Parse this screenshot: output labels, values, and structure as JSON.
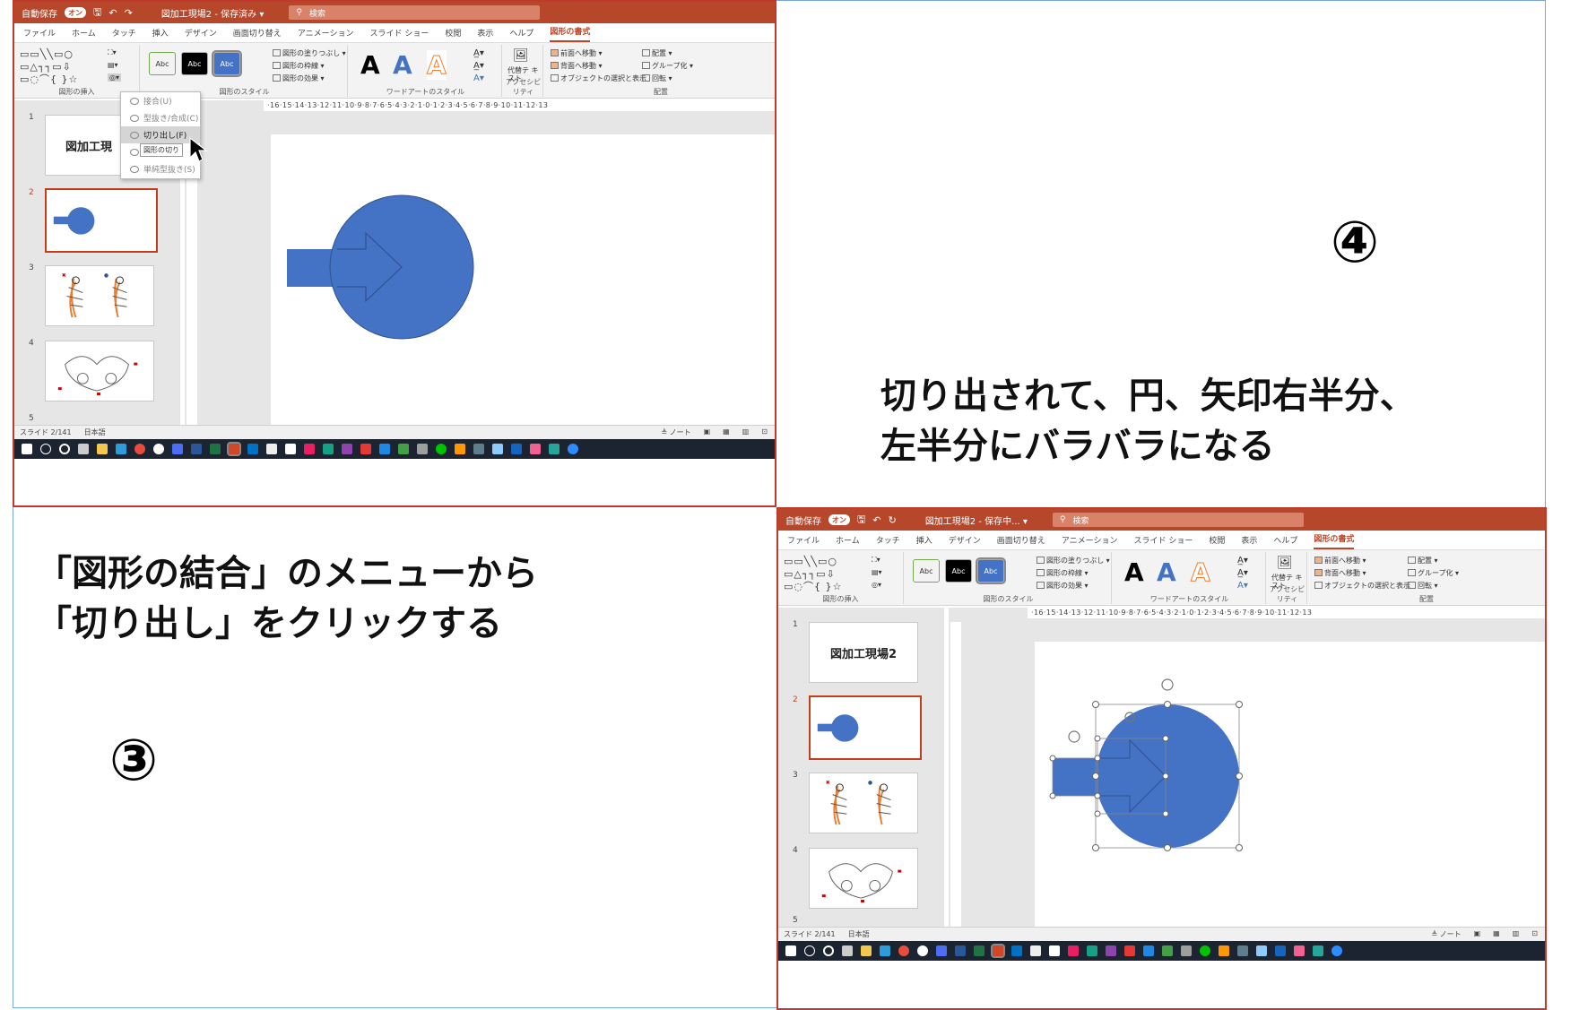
{
  "annotations": {
    "step3_number": "③",
    "step3_line1": "「図形の結合」のメニューから",
    "step3_line2": "「切り出し」をクリックする",
    "step4_number": "④",
    "step4_line1": "切り出されて、円、矢印右半分、",
    "step4_line2": "左半分にバラバラになる"
  },
  "colors": {
    "accent": "#b7472a",
    "shape_fill": "#4472c4",
    "shape_stroke": "#2f528f",
    "callout_border": "#c0392b"
  },
  "shot_a": {
    "title": {
      "autosave": "自動保存",
      "toggle": "オン",
      "doc": "図加工現場2 - 保存済み ▾",
      "search": "検索"
    },
    "tabs": [
      "ファイル",
      "ホーム",
      "タッチ",
      "挿入",
      "デザイン",
      "画面切り替え",
      "アニメーション",
      "スライド ショー",
      "校閲",
      "表示",
      "ヘルプ",
      "図形の書式"
    ],
    "ribbon": {
      "insert_shapes": "図形の挿入",
      "shape_styles": "図形のスタイル",
      "wordart_styles": "ワードアートのスタイル",
      "accessibility": "アクセシビリティ",
      "arrange": "配置",
      "alt_text": "代替テ キスト",
      "fill": "図形の塗りつぶし ▾",
      "outline": "図形の枠線 ▾",
      "effects": "図形の効果 ▾",
      "bring_forward": "前面へ移動",
      "send_backward": "背面へ移動",
      "selection_pane": "オブジェクトの選択と表示",
      "align": "配置 ▾",
      "group": "グループ化 ▾",
      "rotate": "回転 ▾",
      "abc": "Abc",
      "wa_letter": "A"
    },
    "merge_menu": [
      "接合(U)",
      "型抜き/合成(C)",
      "切り出し(F)",
      "重",
      "単純型抜き(S)"
    ],
    "tooltip": "図形の切り",
    "thumb_title": "図加工現",
    "slide_numbers": [
      "1",
      "2",
      "3",
      "4",
      "5"
    ],
    "ruler": "·16·15·14·13·12·11·10·9·8·7·6·5·4·3·2·1·0·1·2·3·4·5·6·7·8·9·10·11·12·13",
    "status": {
      "slide": "スライド 2/141",
      "lang": "日本語",
      "notes": "≜ ノート"
    }
  },
  "shot_b": {
    "title": {
      "autosave": "自動保存",
      "toggle": "オン",
      "doc": "図加工現場2 - 保存中... ▾",
      "search": "検索"
    },
    "thumb_title": "図加工現場2",
    "slide_numbers": [
      "1",
      "2",
      "3",
      "4",
      "5"
    ],
    "status": {
      "slide": "スライド 2/141",
      "lang": "日本語",
      "notes": "≜ ノート"
    }
  }
}
